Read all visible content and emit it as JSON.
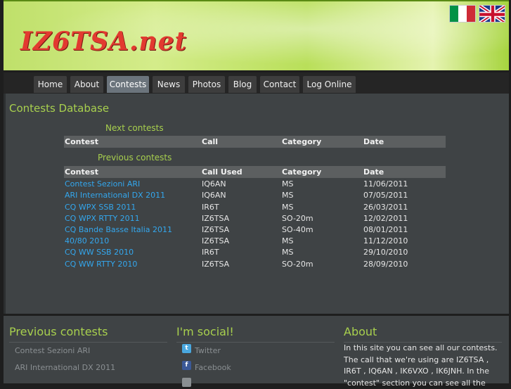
{
  "header": {
    "logo": "IZ6TSA.net"
  },
  "nav": [
    "Home",
    "About",
    "Contests",
    "News",
    "Photos",
    "Blog",
    "Contact",
    "Log Online"
  ],
  "page_title": "Contests Database",
  "next": {
    "label": "Next contests",
    "headers": [
      "Contest",
      "Call",
      "Category",
      "Date"
    ]
  },
  "previous": {
    "label": "Previous contests",
    "headers": [
      "Contest",
      "Call Used",
      "Category",
      "Date"
    ],
    "rows": [
      [
        "Contest Sezioni ARI",
        "IQ6AN",
        "MS",
        "11/06/2011"
      ],
      [
        "ARI International DX 2011",
        "IQ6AN",
        "MS",
        "07/05/2011"
      ],
      [
        "CQ WPX SSB 2011",
        "IR6T",
        "MS",
        "26/03/2011"
      ],
      [
        "CQ WPX RTTY 2011",
        "IZ6TSA",
        "SO-20m",
        "12/02/2011"
      ],
      [
        "CQ Bande Basse Italia 2011",
        "IZ6TSA",
        "SO-40m",
        "08/01/2011"
      ],
      [
        "40/80 2010",
        "IZ6TSA",
        "MS",
        "11/12/2010"
      ],
      [
        "CQ WW SSB 2010",
        "IR6T",
        "MS",
        "29/10/2010"
      ],
      [
        "CQ WW RTTY 2010",
        "IZ6TSA",
        "SO-20m",
        "28/09/2010"
      ]
    ]
  },
  "footer": {
    "previous_title": "Previous contests",
    "previous_links": [
      "Contest Sezioni ARI",
      "ARI International DX 2011"
    ],
    "social_title": "I'm social!",
    "social_links": [
      "Twitter",
      "Facebook"
    ],
    "about_title": "About",
    "about_text": "In this site you can see all our contests. The call that we're using are IZ6TSA , IR6T , IQ6AN , IK6VXO , IK6JNH. In the \"contest\" section you can see all the"
  },
  "colors": {
    "accent": "#a8d04e",
    "link": "#33a7ee",
    "logo": "#e23a30"
  }
}
